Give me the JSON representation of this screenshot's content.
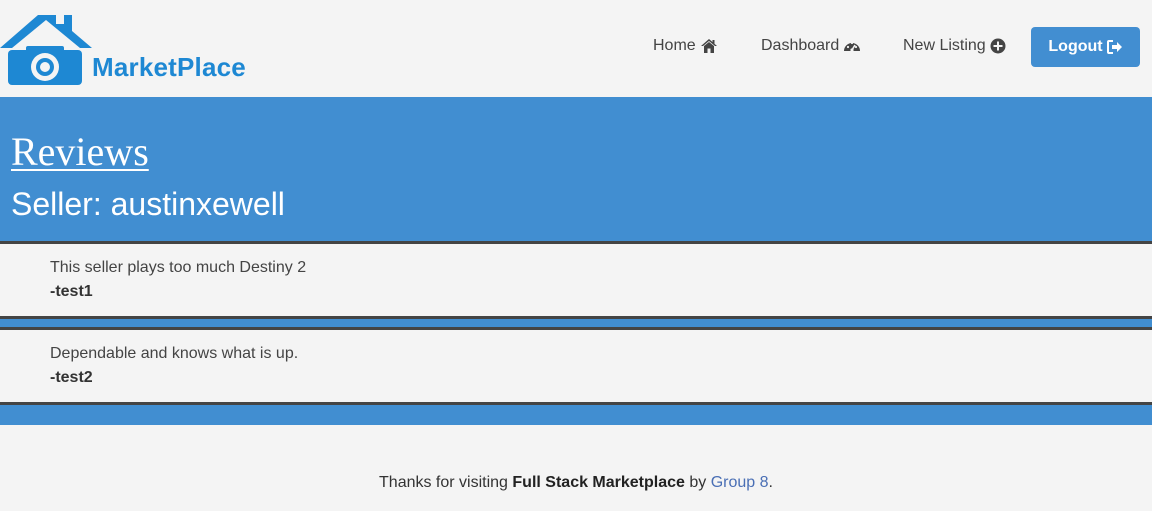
{
  "brand": {
    "name": "MarketPlace",
    "color": "#1e88d3"
  },
  "nav": {
    "home": {
      "label": "Home",
      "icon": "home-icon"
    },
    "dashboard": {
      "label": "Dashboard",
      "icon": "dashboard-icon"
    },
    "new_listing": {
      "label": "New Listing",
      "icon": "plus-circle-icon"
    },
    "logout": {
      "label": "Logout",
      "icon": "sign-out-icon"
    }
  },
  "header": {
    "title": "Reviews",
    "seller_line": "Seller: austinxewell"
  },
  "reviews": [
    {
      "text": "This seller plays too much Destiny 2",
      "author": "-test1"
    },
    {
      "text": "Dependable and knows what is up.",
      "author": "-test2"
    }
  ],
  "footer": {
    "prefix": "Thanks for visiting ",
    "site": "Full Stack Marketplace",
    "by": " by ",
    "group": "Group 8",
    "suffix": "."
  },
  "colors": {
    "accent": "#418ed1",
    "background": "#f4f4f4",
    "divider": "#444444"
  }
}
